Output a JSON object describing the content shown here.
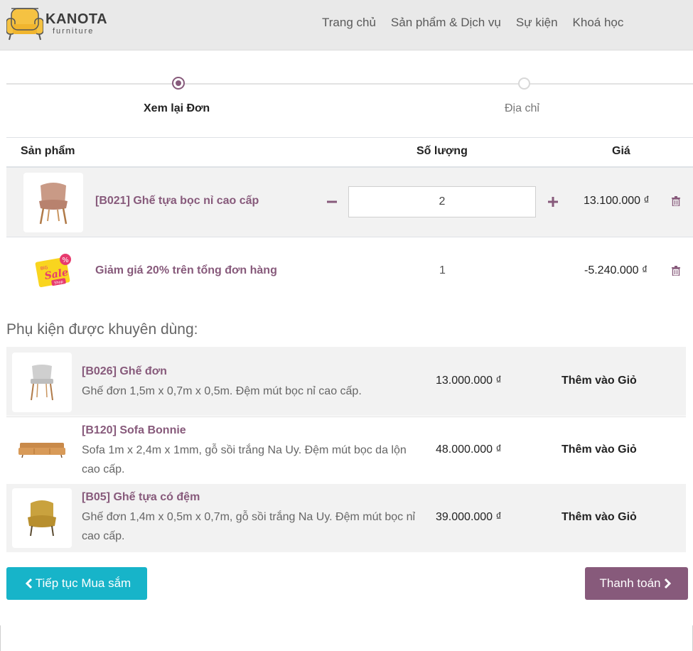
{
  "header": {
    "logo_name": "KANOTA",
    "logo_sub": "furniture",
    "nav": [
      "Trang chủ",
      "Sản phẩm & Dịch vụ",
      "Sự kiện",
      "Khoá học"
    ]
  },
  "steps": [
    {
      "label": "Xem lại Đơn",
      "active": true
    },
    {
      "label": "Địa chỉ",
      "active": false
    }
  ],
  "cart": {
    "columns": {
      "product": "Sản phẩm",
      "quantity": "Số lượng",
      "price": "Giá"
    },
    "lines": [
      {
        "name": "[B021] Ghế tựa bọc nỉ cao cấp",
        "qty": "2",
        "price": "13.100.000 ₫"
      },
      {
        "name": "Giảm giá 20% trên tổng đơn hàng",
        "qty": "1",
        "price": "-5.240.000 ₫"
      }
    ]
  },
  "accessories": {
    "title": "Phụ kiện được khuyên dùng:",
    "items": [
      {
        "name": "[B026] Ghế đơn",
        "desc": "Ghế đơn 1,5m x 0,7m x 0,5m. Đệm mút bọc nỉ cao cấp.",
        "price": "13.000.000 ₫",
        "add": "Thêm vào Giỏ"
      },
      {
        "name": "[B120] Sofa Bonnie",
        "desc": "Sofa 1m x 2,4m x 1mm, gỗ sồi trắng Na Uy. Đệm mút bọc da lộn cao cấp.",
        "price": "48.000.000 ₫",
        "add": "Thêm vào Giỏ"
      },
      {
        "name": "[B05] Ghế tựa có đệm",
        "desc": "Ghế đơn 1,4m x 0,5m x 0,7m, gỗ sồi trắng Na Uy. Đệm mút bọc nỉ cao cấp.",
        "price": "39.000.000 ₫",
        "add": "Thêm vào Giỏ"
      }
    ]
  },
  "actions": {
    "continue": "Tiếp tục Mua sắm",
    "checkout": "Thanh toán"
  },
  "sale_badge": {
    "big": "BIG",
    "sale": "Sale",
    "percent": "%",
    "tag": "Shop"
  },
  "colors": {
    "accent": "#875a7b",
    "continue_button": "#17b4c9"
  }
}
